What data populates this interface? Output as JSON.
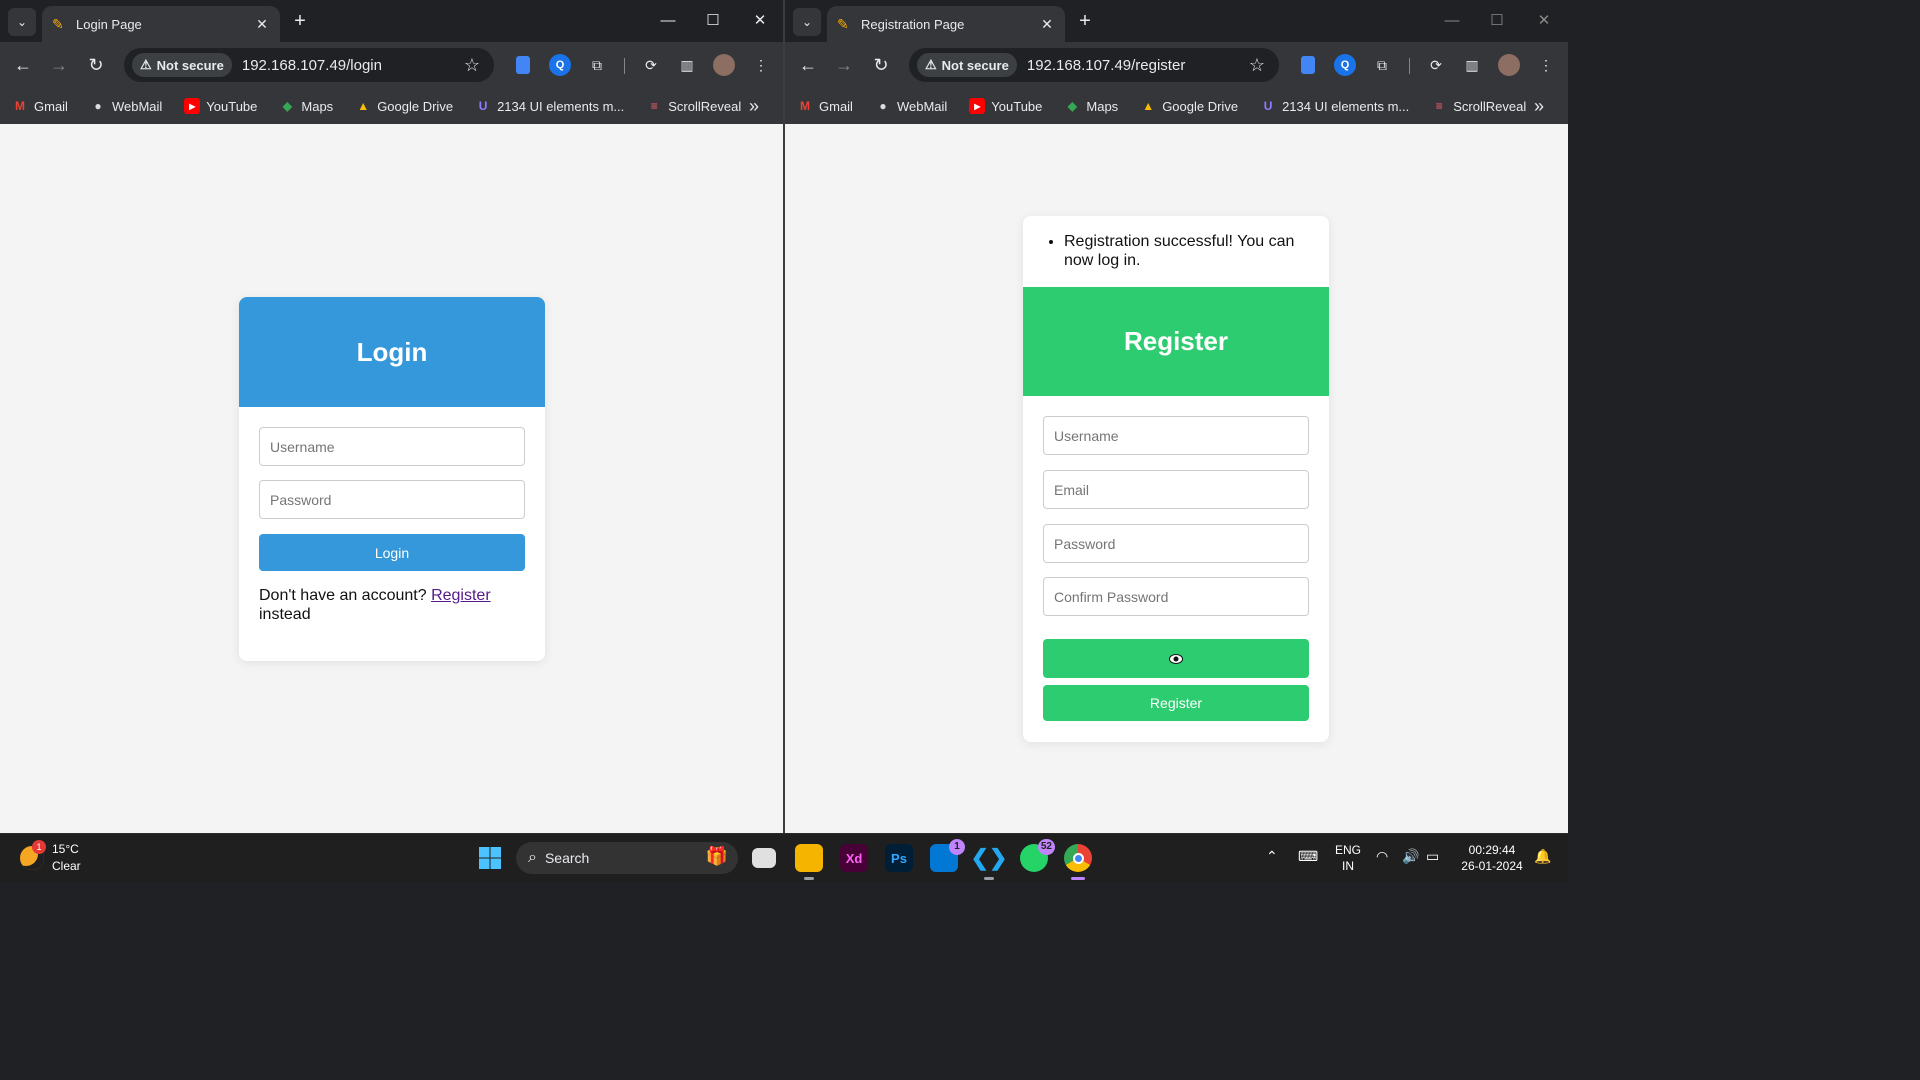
{
  "colors": {
    "login_accent": "#3498db",
    "register_accent": "#2ecc71",
    "link_visited": "#551a8b"
  },
  "left_window": {
    "tab_title": "Login Page",
    "security_label": "Not secure",
    "url": "192.168.107.49/login",
    "bookmarks": [
      "Gmail",
      "WebMail",
      "YouTube",
      "Maps",
      "Google Drive",
      "2134 UI elements m...",
      "ScrollReveal"
    ],
    "page": {
      "heading": "Login",
      "username_placeholder": "Username",
      "password_placeholder": "Password",
      "button_label": "Login",
      "footer_text_1": "Don't have an account?",
      "footer_link": "Register",
      "footer_text_2": "instead"
    }
  },
  "right_window": {
    "tab_title": "Registration Page",
    "security_label": "Not secure",
    "url": "192.168.107.49/register",
    "bookmarks": [
      "Gmail",
      "WebMail",
      "YouTube",
      "Maps",
      "Google Drive",
      "2134 UI elements m...",
      "ScrollReveal"
    ],
    "page": {
      "message": "Registration successful! You can now log in.",
      "heading": "Register",
      "username_placeholder": "Username",
      "email_placeholder": "Email",
      "password_placeholder": "Password",
      "confirm_placeholder": "Confirm Password",
      "toggle_icon": "eye-icon",
      "button_label": "Register"
    }
  },
  "taskbar": {
    "weather_temp": "15°C",
    "weather_desc": "Clear",
    "weather_badge": "1",
    "search_label": "Search",
    "apps": [
      "start",
      "search",
      "task-view",
      "file-explorer",
      "adobe-xd",
      "photoshop",
      "store",
      "vscode",
      "whatsapp",
      "chrome"
    ],
    "store_badge": "1",
    "whatsapp_badge": "52",
    "xd_label": "Xd",
    "ps_label": "Ps",
    "lang_line1": "ENG",
    "lang_line2": "IN",
    "time": "00:29:44",
    "date": "26-01-2024"
  }
}
